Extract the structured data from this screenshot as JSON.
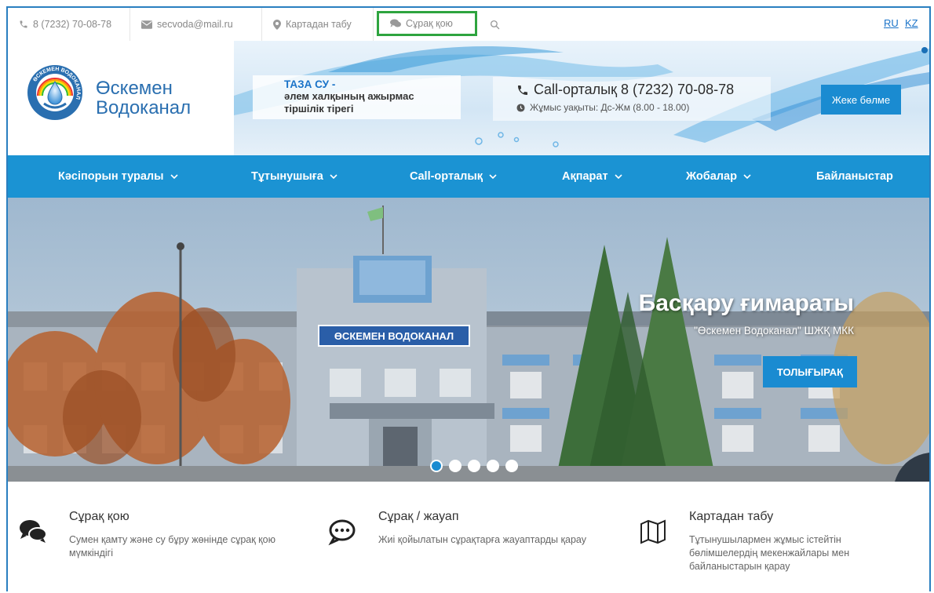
{
  "topbar": {
    "phone": "8 (7232) 70-08-78",
    "email": "secvoda@mail.ru",
    "map": "Картадан табу",
    "ask": "Сұрақ қою",
    "lang_ru": "RU",
    "lang_kz": "KZ"
  },
  "header": {
    "logo_line1": "Өскемен",
    "logo_line2": "Водоканал",
    "logo_ring_text": "ӨСКЕМЕН ВОДОКАНАЛ",
    "slogan_title": "ТАЗА СУ -",
    "slogan_line1": "әлем халқының ажырмас",
    "slogan_line2": "тіршілік тірегі",
    "call_center": "Call-орталық 8 (7232) 70-08-78",
    "work_hours": "Жұмыс уақыты: Дс-Жм (8.00 - 18.00)",
    "cabinet_button": "Жеке бөлме"
  },
  "nav": [
    {
      "label": "Кәсіпорын туралы",
      "chevron": true
    },
    {
      "label": "Тұтынушыға",
      "chevron": true
    },
    {
      "label": "Call-орталық",
      "chevron": true
    },
    {
      "label": "Ақпарат",
      "chevron": true
    },
    {
      "label": "Жобалар",
      "chevron": true
    },
    {
      "label": "Байланыстар",
      "chevron": false
    }
  ],
  "hero": {
    "title": "Басқару ғимараты",
    "subtitle": "\"Өскемен Водоканал\" ШЖҚ МКК",
    "button": "ТОЛЫҒЫРАҚ",
    "building_sign": "ӨСКЕМЕН ВОДОКАНАЛ",
    "slides": 5,
    "active_slide": 1
  },
  "features": [
    {
      "icon": "chat-bubbles-icon",
      "title": "Сұрақ қою",
      "desc": "Сумен қамту және су бұру жөнінде сұрақ қою мүмкіндігі"
    },
    {
      "icon": "comment-dots-icon",
      "title": "Сұрақ / жауап",
      "desc": "Жиі қойылатын сұрақтарға жауаптарды қарау"
    },
    {
      "icon": "map-icon",
      "title": "Картадан табу",
      "desc": "Тұтынушылармен жұмыс істейтін бөлімшелердің мекенжайлары мен байланыстарын қарау"
    }
  ],
  "colors": {
    "accent": "#1b93d3",
    "highlight": "#2ea43f",
    "link": "#1a73c8"
  }
}
